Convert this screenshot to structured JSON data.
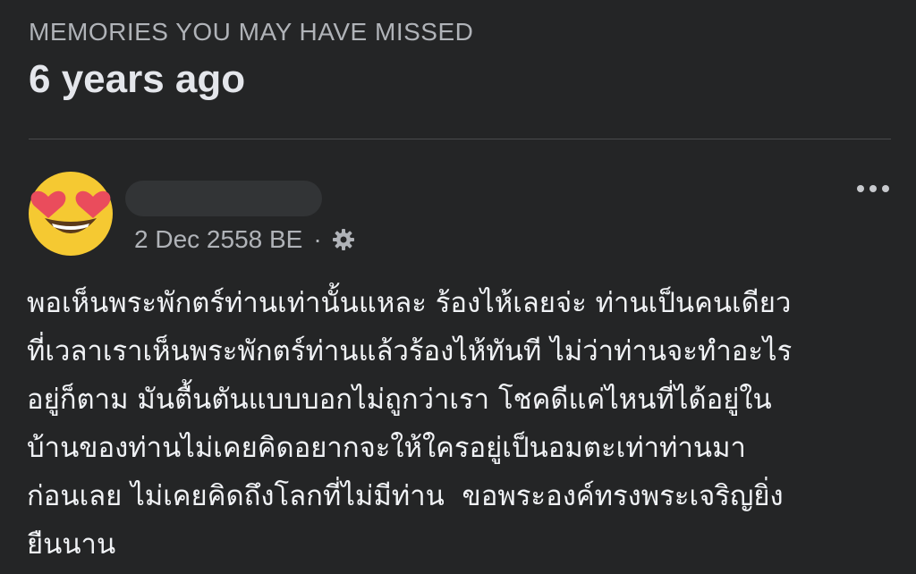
{
  "memories": {
    "label": "MEMORIES YOU MAY HAVE MISSED",
    "title": "6 years ago"
  },
  "post": {
    "date": "2 Dec 2558 BE",
    "separator": "·",
    "privacy_icon": "gear-icon",
    "more_icon": "more-options-icon",
    "avatar_icon": "heart-eyes-emoji",
    "text": "พอเห็นพระพักตร์ท่านเท่านั้นแหละ ร้องไห้เลยจ่ะ ท่านเป็นคนเดียว\nที่เวลาเราเห็นพระพักตร์ท่านแล้วร้องไห้ทันที ไม่ว่าท่านจะทำอะไร\nอยู่ก็ตาม มันตื้นตันแบบบอกไม่ถูกว่าเรา โชคดีแค่ไหนที่ได้อยู่ใน\nบ้านของท่านไม่เคยคิดอยากจะให้ใครอยู่เป็นอมตะเท่าท่านมา\nก่อนเลย ไม่เคยคิดถึงโลกที่ไม่มีท่าน  ขอพระองค์ทรงพระเจริญยิ่ง\nยืนนาน"
  },
  "colors": {
    "background": "#242526",
    "primary_text": "#e4e6eb",
    "secondary_text": "#b0b3b8"
  }
}
